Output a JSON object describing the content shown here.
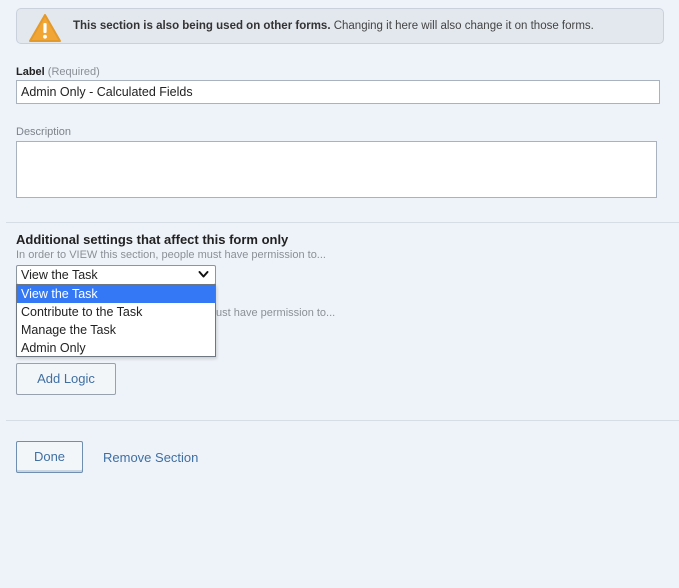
{
  "warning": {
    "icon": "warning-triangle-icon",
    "bold_text": "This section is also being used on other forms.",
    "text": " Changing it here will also change it on those forms."
  },
  "label_field": {
    "label": "Label",
    "required_hint": "(Required)",
    "value": "Admin Only - Calculated Fields"
  },
  "description_field": {
    "label": "Description",
    "value": ""
  },
  "additional_settings": {
    "heading": "Additional settings that affect this form only",
    "view_help": "In order to VIEW this section, people must have permission to...",
    "view_select": {
      "selected": "View the Task",
      "options": [
        "View the Task",
        "Contribute to the Task",
        "Manage the Task",
        "Admin Only"
      ]
    },
    "edit_help_partial": "ust have permission to..."
  },
  "buttons": {
    "add_logic": "Add Logic",
    "done": "Done",
    "remove_section": "Remove Section"
  },
  "colors": {
    "accent": "#3f6fa3",
    "selected_option": "#3478f6",
    "warning_icon": "#f0a535",
    "background": "#eef3f9"
  }
}
